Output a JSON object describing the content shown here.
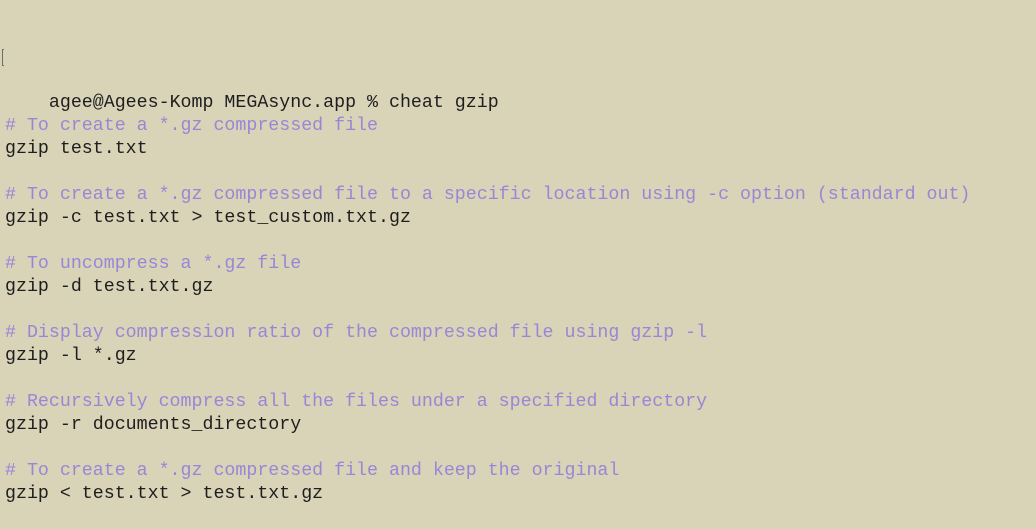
{
  "terminal": {
    "prompt": "agee@Agees-Komp MEGAsync.app % cheat gzip",
    "lines": [
      {
        "type": "comment",
        "text": "# To create a *.gz compressed file"
      },
      {
        "type": "command",
        "text": "gzip test.txt"
      },
      {
        "type": "blank",
        "text": ""
      },
      {
        "type": "comment",
        "text": "# To create a *.gz compressed file to a specific location using -c option (standard out)"
      },
      {
        "type": "command",
        "text": "gzip -c test.txt > test_custom.txt.gz"
      },
      {
        "type": "blank",
        "text": ""
      },
      {
        "type": "comment",
        "text": "# To uncompress a *.gz file"
      },
      {
        "type": "command",
        "text": "gzip -d test.txt.gz"
      },
      {
        "type": "blank",
        "text": ""
      },
      {
        "type": "comment",
        "text": "# Display compression ratio of the compressed file using gzip -l"
      },
      {
        "type": "command",
        "text": "gzip -l *.gz"
      },
      {
        "type": "blank",
        "text": ""
      },
      {
        "type": "comment",
        "text": "# Recursively compress all the files under a specified directory"
      },
      {
        "type": "command",
        "text": "gzip -r documents_directory"
      },
      {
        "type": "blank",
        "text": ""
      },
      {
        "type": "comment",
        "text": "# To create a *.gz compressed file and keep the original"
      },
      {
        "type": "command",
        "text": "gzip < test.txt > test.txt.gz"
      }
    ]
  },
  "colors": {
    "background": "#d9d3b8",
    "comment": "#9a86d6",
    "text": "#1e1e1e"
  }
}
